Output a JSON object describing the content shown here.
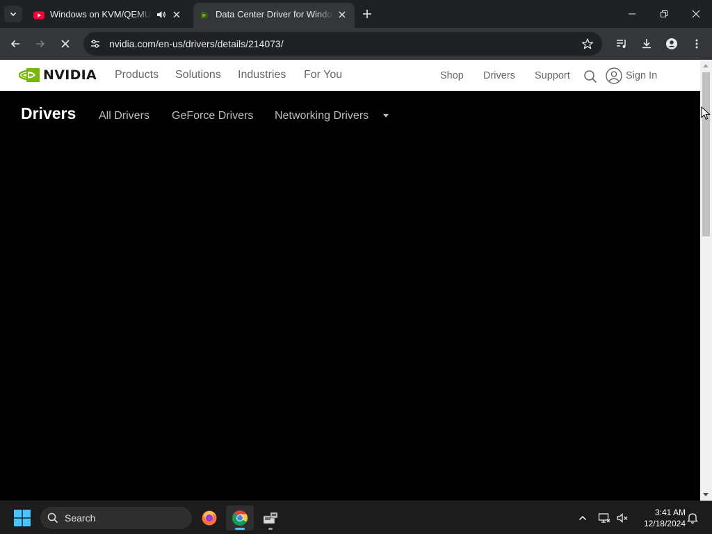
{
  "browser": {
    "tabs": [
      {
        "title": "Windows on KVM/QEMU: C",
        "active": false,
        "favicon": "youtube-icon",
        "audio": true
      },
      {
        "title": "Data Center Driver for Windows",
        "active": true,
        "favicon": "nvidia-favicon",
        "audio": false
      }
    ],
    "address": "nvidia.com/en-us/drivers/details/214073/",
    "colors": {
      "tabstrip": "#202124",
      "toolbar": "#35363a",
      "omnibox": "#202124",
      "accent": "#76b900"
    }
  },
  "page": {
    "brand": "NVIDIA",
    "main_nav": [
      "Products",
      "Solutions",
      "Industries",
      "For You"
    ],
    "util_nav": {
      "shop": "Shop",
      "drivers": "Drivers",
      "support": "Support",
      "sign_in": "Sign In"
    },
    "subnav": {
      "title": "Drivers",
      "links": [
        "All Drivers",
        "GeForce Drivers",
        "Networking Drivers"
      ]
    }
  },
  "taskbar": {
    "search_label": "Search",
    "time": "3:41 AM",
    "date": "12/18/2024",
    "apps": [
      "firefox-icon",
      "chrome-icon",
      "virt-manager-icon"
    ]
  }
}
